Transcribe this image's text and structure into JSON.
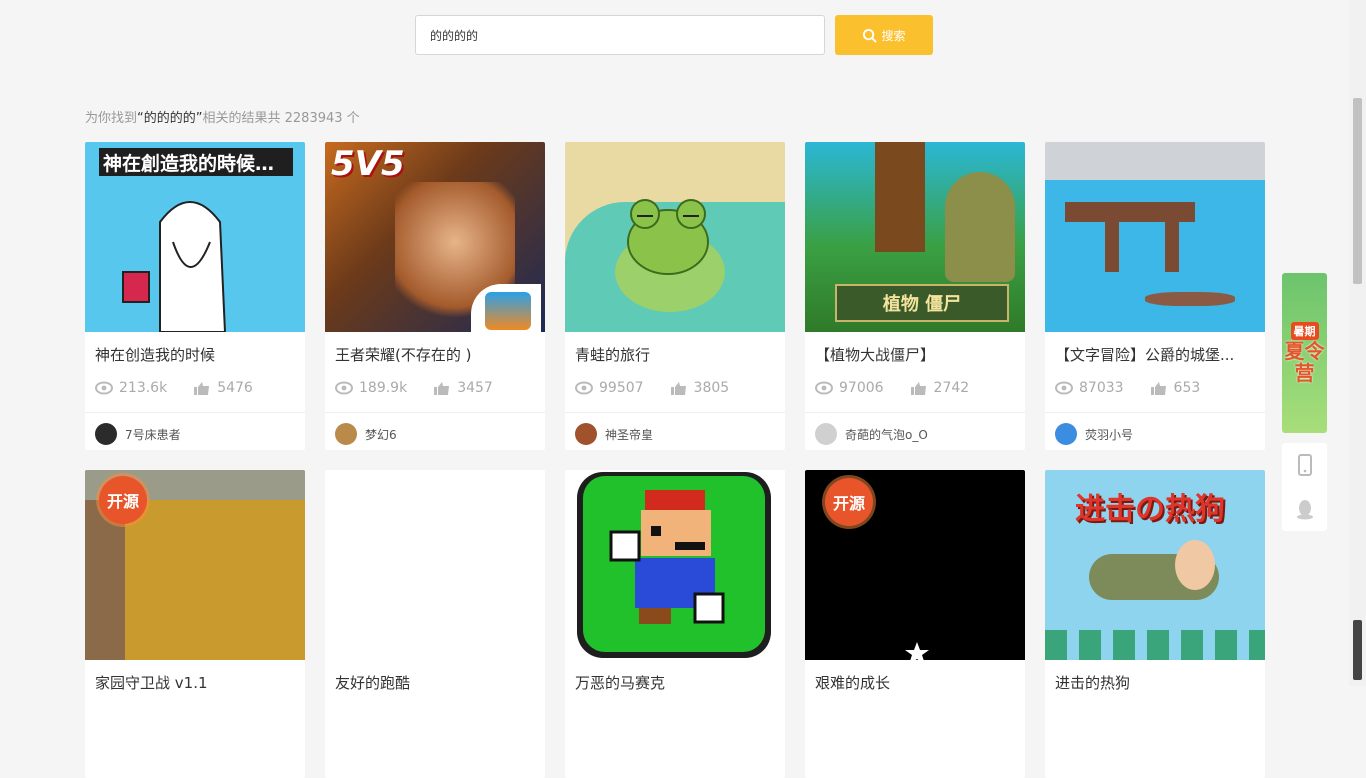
{
  "search": {
    "value": "的的的的",
    "button_label": "搜索"
  },
  "summary": {
    "prefix": "为你找到",
    "keyword": "“的的的的”",
    "suffix": "相关的结果共 2283943 个"
  },
  "cards": [
    {
      "title": "神在创造我的时候",
      "views": "213.6k",
      "likes": "5476",
      "author": "7号床患者",
      "thumb_text": "神在創造我的時候…",
      "avatar_color": "#2b2b2b"
    },
    {
      "title": "王者荣耀(不存在的 )",
      "views": "189.9k",
      "likes": "3457",
      "author": "梦幻6",
      "thumb_text": "5V5",
      "avatar_color": "#b98a4a"
    },
    {
      "title": "青蛙的旅行",
      "views": "99507",
      "likes": "3805",
      "author": "神圣帝皇",
      "thumb_text": "",
      "avatar_color": "#a0522d"
    },
    {
      "title": "【植物大战僵尸】",
      "views": "97006",
      "likes": "2742",
      "author": "奇葩的气泡o_O",
      "thumb_text": "植物 僵尸",
      "avatar_color": "#d0d0d0"
    },
    {
      "title": "【文字冒险】公爵的城堡...",
      "views": "87033",
      "likes": "653",
      "author": "荧羽小号",
      "thumb_text": "",
      "avatar_color": "#3a8de0"
    },
    {
      "title": "家园守卫战 v1.1",
      "views": "",
      "likes": "",
      "author": "",
      "badge": "开源",
      "avatar_color": ""
    },
    {
      "title": "友好的跑酷",
      "views": "",
      "likes": "",
      "author": "",
      "avatar_color": ""
    },
    {
      "title": "万恶的马赛克",
      "views": "",
      "likes": "",
      "author": "",
      "avatar_color": ""
    },
    {
      "title": "艰难的成长",
      "views": "",
      "likes": "",
      "author": "",
      "badge": "开源",
      "avatar_color": ""
    },
    {
      "title": "进击的热狗",
      "views": "",
      "likes": "",
      "author": "",
      "thumb_text": "进击の热狗",
      "avatar_color": ""
    }
  ],
  "promo": {
    "tag": "暑期",
    "label": "夏令营"
  },
  "colors": {
    "accent": "#fbc02d",
    "background": "#f5f5f5",
    "badge": "#e8552b"
  }
}
